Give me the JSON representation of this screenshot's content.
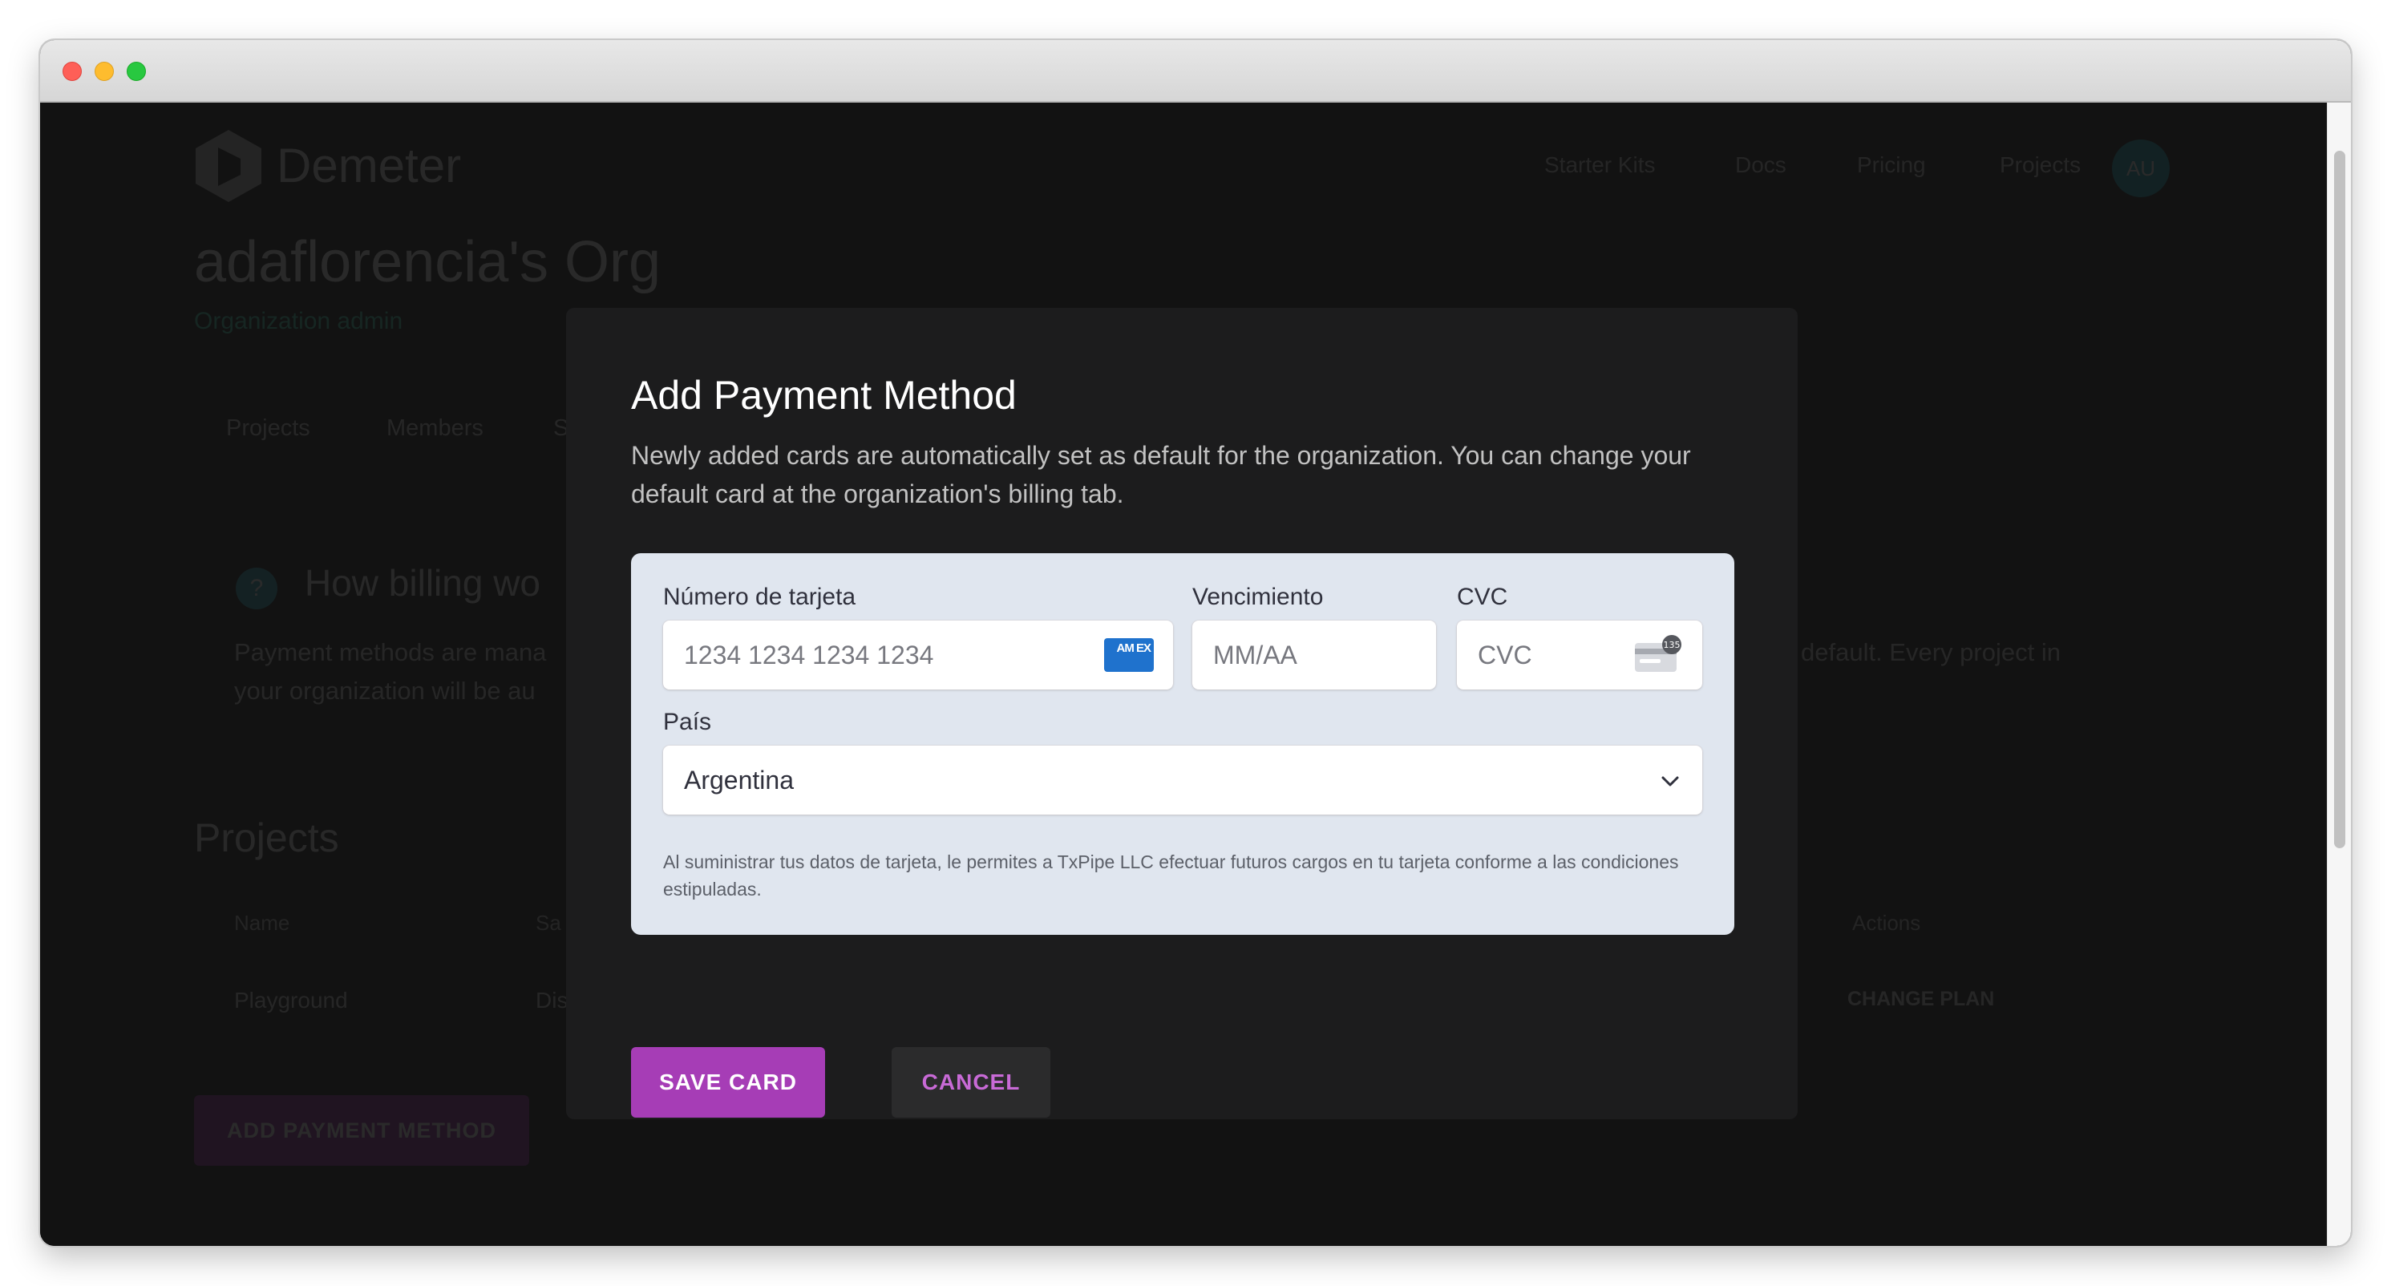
{
  "app": {
    "brand": "Demeter",
    "nav": [
      "Starter Kits",
      "Docs",
      "Pricing",
      "Projects"
    ],
    "avatar_initials": "AU"
  },
  "org": {
    "title": "adaflorencia's Org",
    "subtitle": "Organization admin",
    "tabs": [
      "Projects",
      "Members",
      "S"
    ]
  },
  "billing": {
    "title": "How billing wo",
    "text_left_1": "Payment methods are mana",
    "text_left_2": "your organization will be au",
    "text_right_1": "default. Every project in"
  },
  "projects": {
    "title": "Projects",
    "headers": [
      "Name",
      "Sa",
      "Actions"
    ],
    "row": [
      "Playground",
      "Dis",
      "CHANGE PLAN"
    ],
    "add_payment_label": "ADD PAYMENT METHOD"
  },
  "modal": {
    "title": "Add Payment Method",
    "description": "Newly added cards are automatically set as default for the organization. You can change your default card at the organization's billing tab.",
    "card_number_label": "Número de tarjeta",
    "card_number_placeholder": "1234 1234 1234 1234",
    "expiry_label": "Vencimiento",
    "expiry_placeholder": "MM/AA",
    "cvc_label": "CVC",
    "cvc_placeholder": "CVC",
    "cvc_badge": "135",
    "card_brand": "AM EX",
    "country_label": "País",
    "country_value": "Argentina",
    "legal_text": "Al suministrar tus datos de tarjeta, le permites a TxPipe LLC efectuar futuros cargos en tu tarjeta conforme a las condiciones estipuladas.",
    "save_label": "SAVE CARD",
    "cancel_label": "CANCEL"
  },
  "colors": {
    "accent": "#a63db6",
    "cancel_text": "#c86ad6",
    "panel": "#e0e6ef",
    "modal_bg": "#1c1c1d"
  }
}
